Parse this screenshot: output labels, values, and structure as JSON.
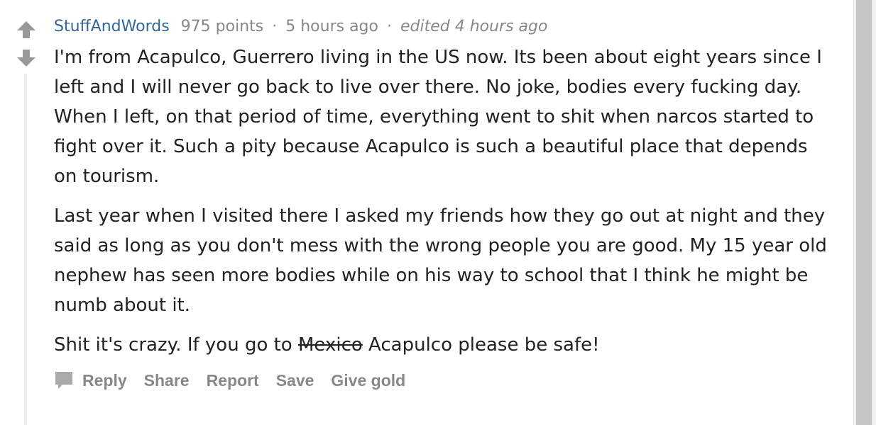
{
  "comment": {
    "author": "StuffAndWords",
    "score": "975 points",
    "time": "5 hours ago",
    "edited": "edited 4 hours ago",
    "separator": "·",
    "paragraphs": [
      "I'm from Acapulco, Guerrero living in the US now. Its been about eight years since I left and I will never go back to live over there. No joke, bodies every fucking day. When I left, on that period of time, everything went to shit when narcos started to fight over it. Such a pity because Acapulco is such a beautiful place that depends on tourism.",
      "Last year when I visited there I asked my friends how they go out at night and they said as long as you don't mess with the wrong people you are good. My 15 year old nephew has seen more bodies while on his way to school that I think he might be numb about it."
    ],
    "last_paragraph": {
      "before": "Shit it's crazy. If you go to ",
      "struck": "Mexico",
      "after": " Acapulco please be safe!"
    }
  },
  "actions": {
    "reply": "Reply",
    "share": "Share",
    "report": "Report",
    "save": "Save",
    "give_gold": "Give gold"
  },
  "icons": {
    "upvote": "upvote-arrow-icon",
    "downvote": "downvote-arrow-icon",
    "reply": "speech-bubble-icon"
  },
  "colors": {
    "author": "#336699",
    "meta": "#888888",
    "text": "#222222",
    "vote_arrow": "#999999"
  }
}
